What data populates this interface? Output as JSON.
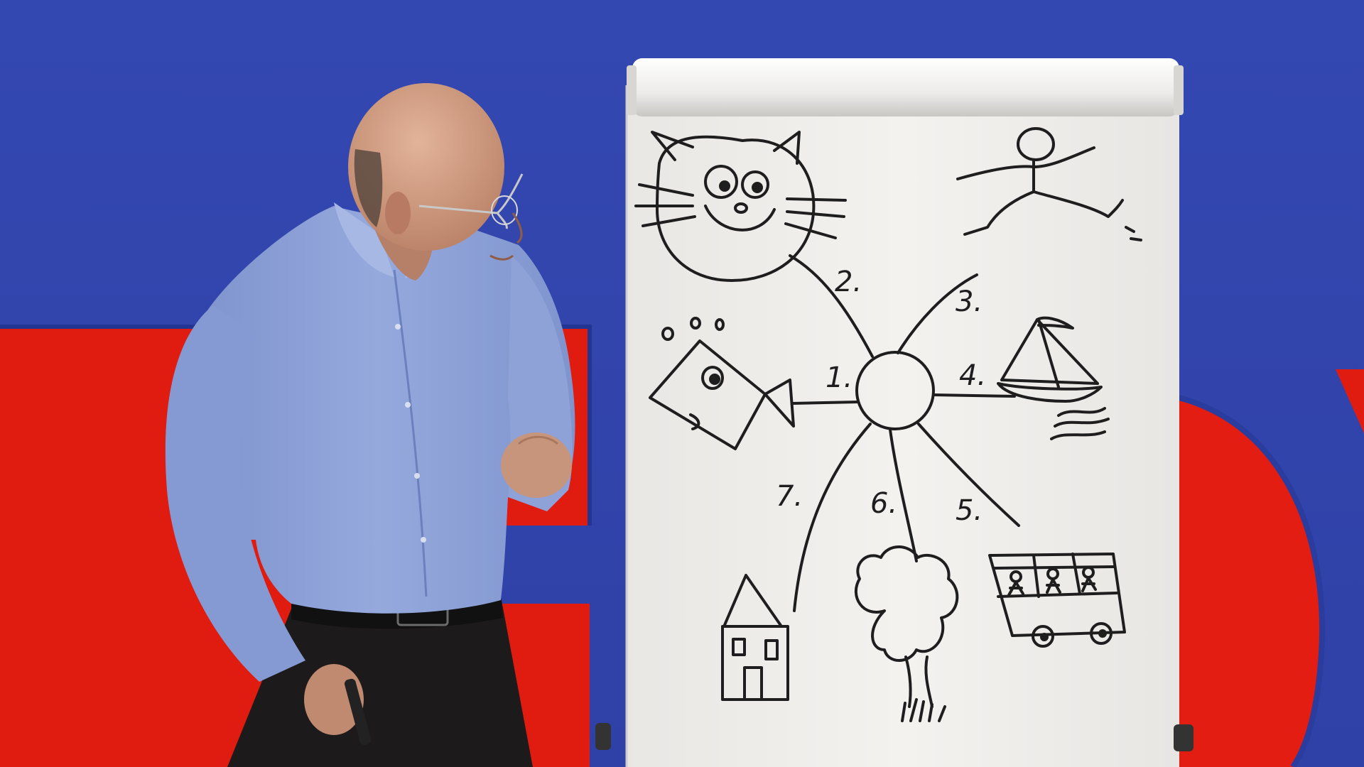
{
  "scene": {
    "description_free": true,
    "colors": {
      "backdrop_blue": "#3a4fb8",
      "backdrop_red": "#e01c10",
      "paper": "#f1efec",
      "ink": "#1e1e1e",
      "shirt": "#8ea3d8",
      "trousers": "#1c1a1a",
      "skin": "#c99a80"
    }
  },
  "flipchart": {
    "labels": [
      "1.",
      "2.",
      "3.",
      "4.",
      "5.",
      "6.",
      "7."
    ]
  }
}
